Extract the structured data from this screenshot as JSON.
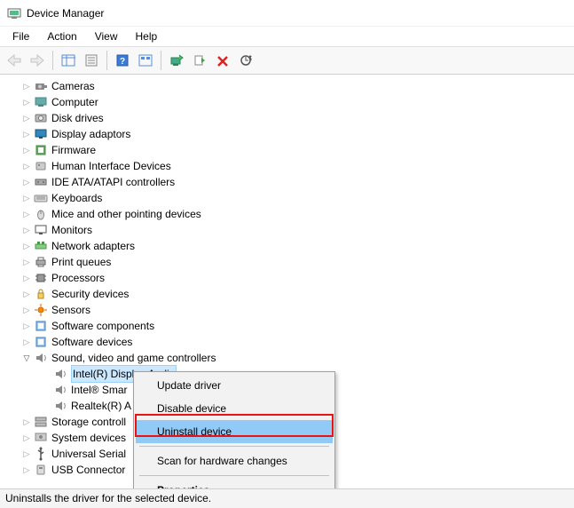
{
  "window": {
    "title": "Device Manager"
  },
  "menu": {
    "file": "File",
    "action": "Action",
    "view": "View",
    "help": "Help"
  },
  "tree": {
    "items": [
      {
        "label": "Cameras",
        "icon": "camera"
      },
      {
        "label": "Computer",
        "icon": "computer"
      },
      {
        "label": "Disk drives",
        "icon": "disk"
      },
      {
        "label": "Display adaptors",
        "icon": "display"
      },
      {
        "label": "Firmware",
        "icon": "firmware"
      },
      {
        "label": "Human Interface Devices",
        "icon": "hid"
      },
      {
        "label": "IDE ATA/ATAPI controllers",
        "icon": "ide"
      },
      {
        "label": "Keyboards",
        "icon": "keyboard"
      },
      {
        "label": "Mice and other pointing devices",
        "icon": "mouse"
      },
      {
        "label": "Monitors",
        "icon": "monitor"
      },
      {
        "label": "Network adapters",
        "icon": "network"
      },
      {
        "label": "Print queues",
        "icon": "printer"
      },
      {
        "label": "Processors",
        "icon": "processor"
      },
      {
        "label": "Security devices",
        "icon": "security"
      },
      {
        "label": "Sensors",
        "icon": "sensor"
      },
      {
        "label": "Software components",
        "icon": "software"
      },
      {
        "label": "Software devices",
        "icon": "software"
      },
      {
        "label": "Sound, video and game controllers",
        "icon": "sound",
        "expanded": true
      },
      {
        "label": "Storage controll",
        "icon": "storage"
      },
      {
        "label": "System devices",
        "icon": "system"
      },
      {
        "label": "Universal Serial",
        "icon": "usb"
      },
      {
        "label": "USB Connector",
        "icon": "usbconn"
      }
    ],
    "sound_children": [
      {
        "label": "Intel(R) Display Audio",
        "selected": true
      },
      {
        "label": "Intel® Smar"
      },
      {
        "label": "Realtek(R) A"
      }
    ]
  },
  "context_menu": {
    "update": "Update driver",
    "disable": "Disable device",
    "uninstall": "Uninstall device",
    "scan": "Scan for hardware changes",
    "properties": "Properties"
  },
  "status": "Uninstalls the driver for the selected device."
}
